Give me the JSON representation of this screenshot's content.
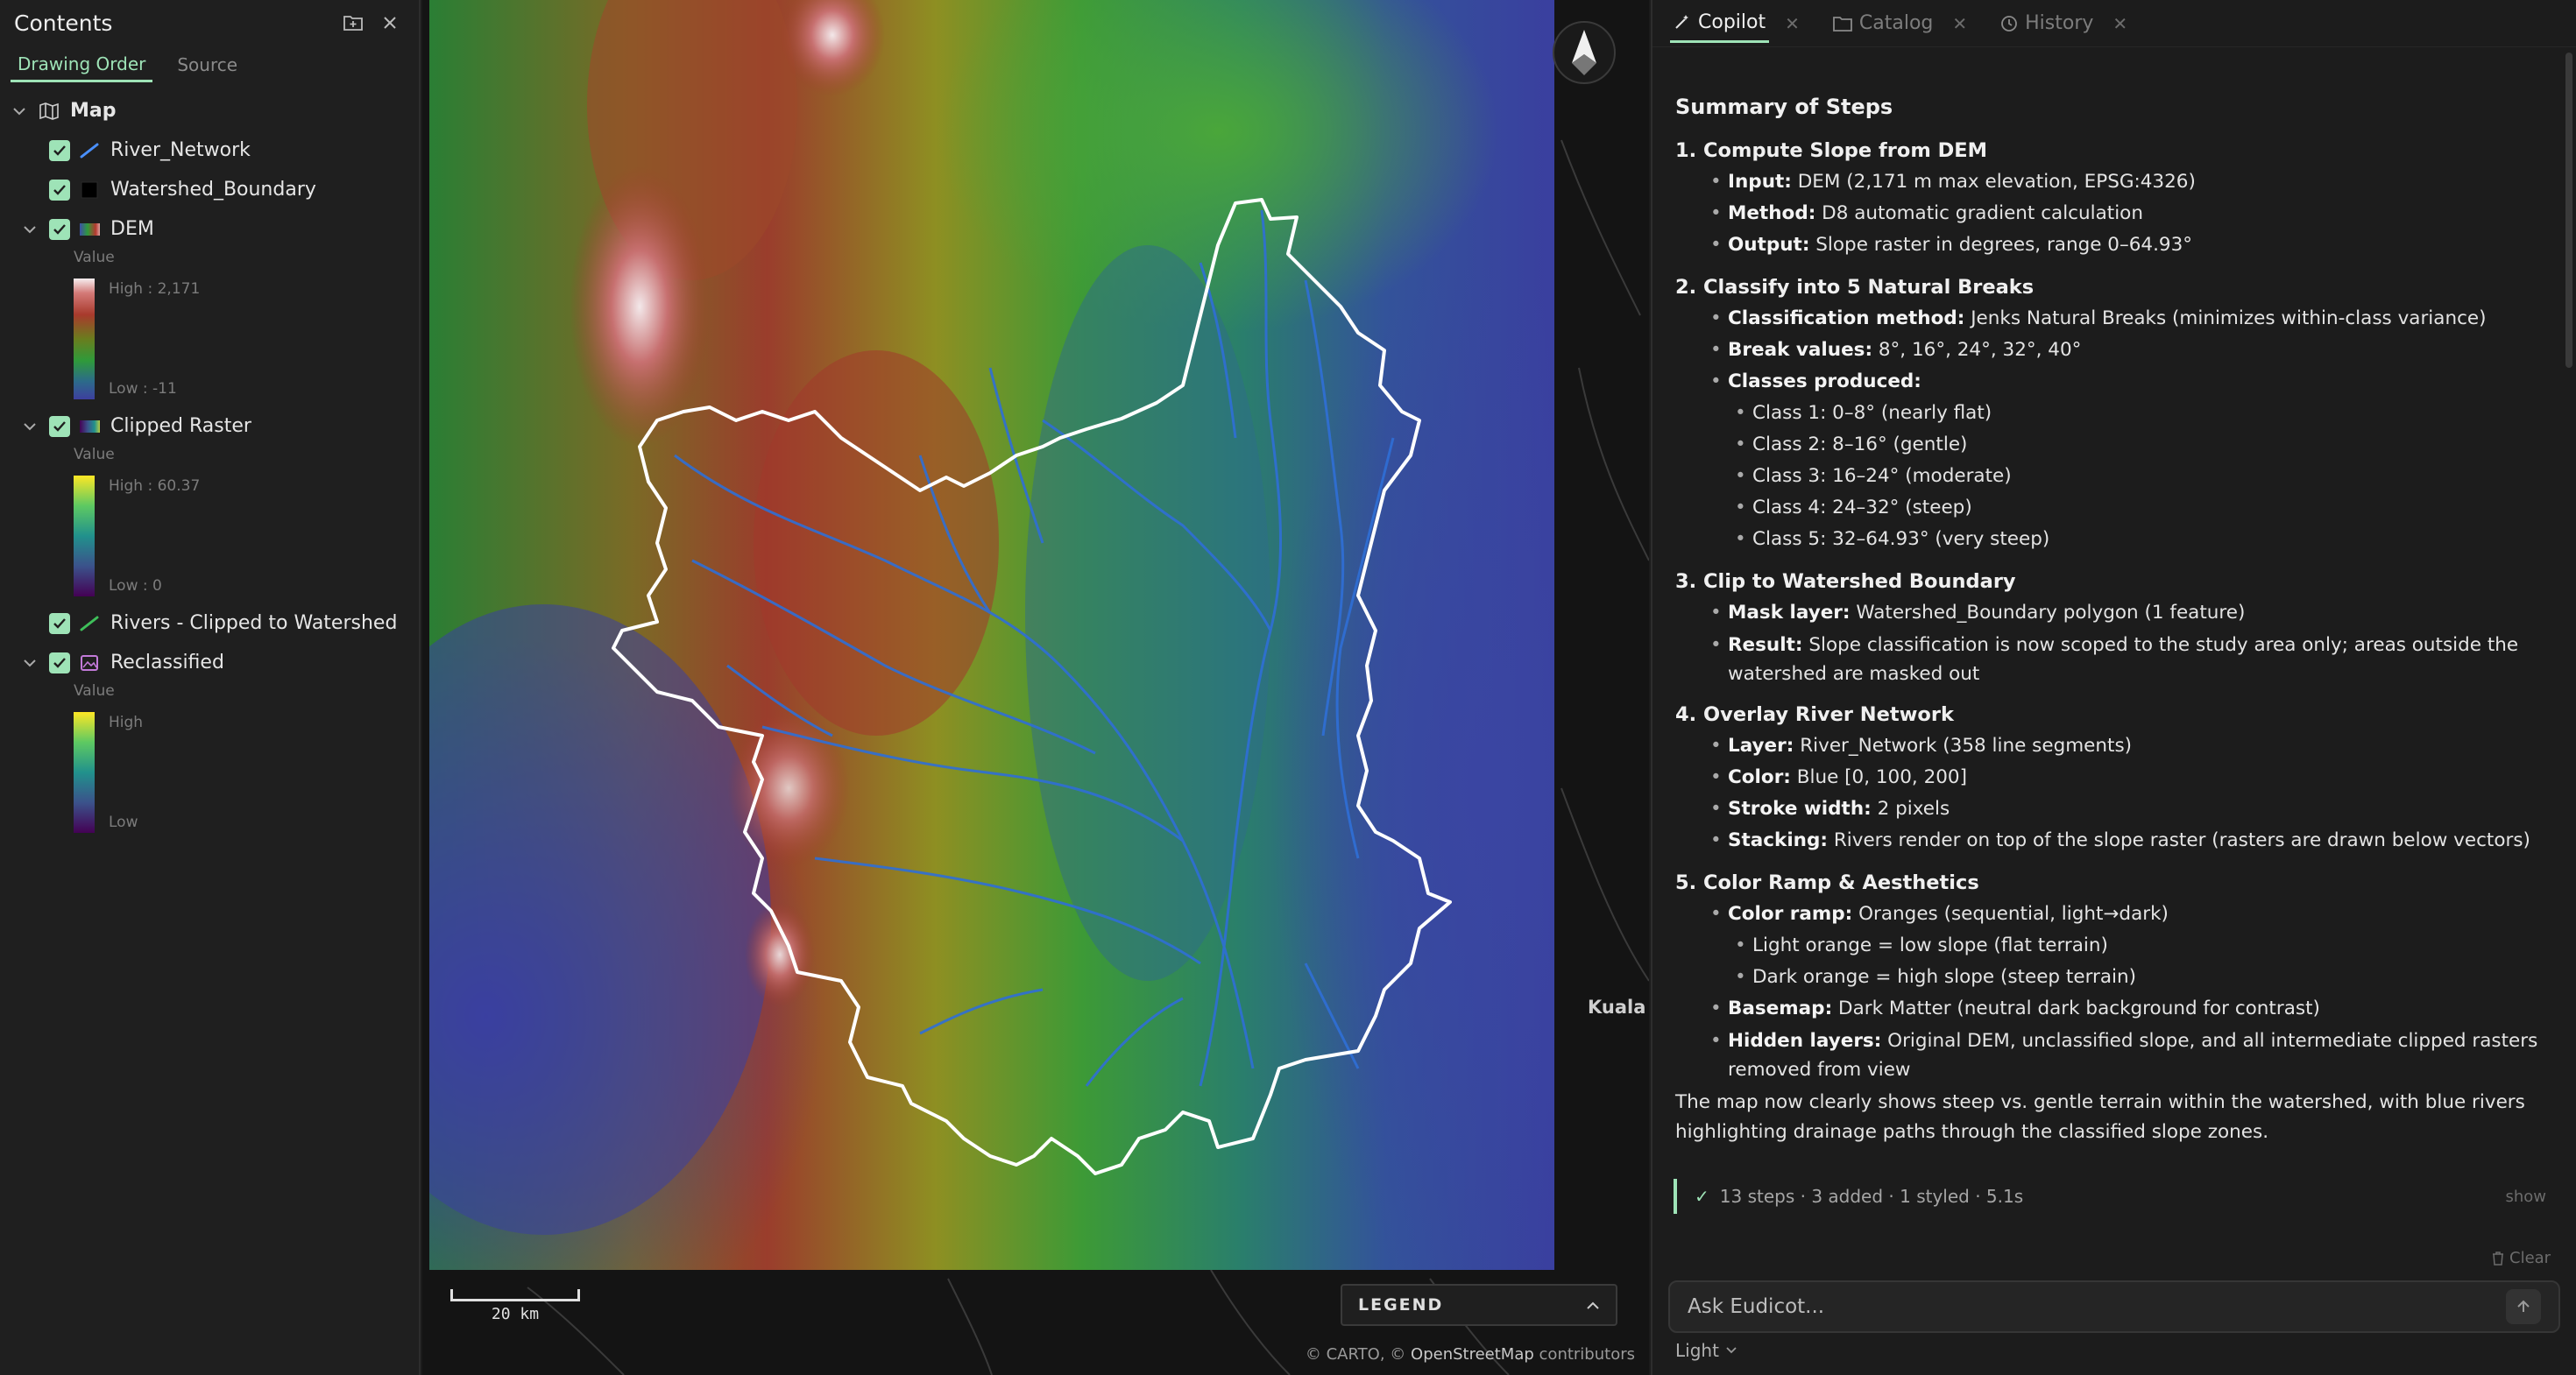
{
  "contents": {
    "title": "Contents",
    "tabs": [
      "Drawing Order",
      "Source"
    ],
    "map_label": "Map",
    "layers": [
      {
        "name": "River_Network"
      },
      {
        "name": "Watershed_Boundary"
      },
      {
        "name": "DEM",
        "legend": {
          "label": "Value",
          "high": "High : 2,171",
          "low": "Low : -11"
        }
      },
      {
        "name": "Clipped Raster",
        "legend": {
          "label": "Value",
          "high": "High : 60.37",
          "low": "Low : 0"
        }
      },
      {
        "name": "Rivers - Clipped to Watershed"
      },
      {
        "name": "Reclassified",
        "legend": {
          "label": "Value",
          "high": "High",
          "low": "Low"
        }
      }
    ]
  },
  "map": {
    "place_label": "Kuala",
    "scale_label": "20 km",
    "legend_button": "LEGEND",
    "attribution_prefix": "© CARTO, ©",
    "attribution_osm": "OpenStreetMap",
    "attribution_suffix": "contributors"
  },
  "copilot": {
    "tabs": [
      {
        "label": "Copilot",
        "icon": "wand-icon"
      },
      {
        "label": "Catalog",
        "icon": "folder-icon"
      },
      {
        "label": "History",
        "icon": "clock-icon"
      }
    ],
    "heading": "Summary of Steps",
    "s1": {
      "title": "1. Compute Slope from DEM",
      "i1k": "Input:",
      "i1v": " DEM (2,171 m max elevation, EPSG:4326)",
      "i2k": "Method:",
      "i2v": " D8 automatic gradient calculation",
      "i3k": "Output:",
      "i3v": " Slope raster in degrees, range 0–64.93°"
    },
    "s2": {
      "title": "2. Classify into 5 Natural Breaks",
      "i1k": "Classification method:",
      "i1v": " Jenks Natural Breaks (minimizes within-class variance)",
      "i2k": "Break values:",
      "i2v": " 8°, 16°, 24°, 32°, 40°",
      "i3k": "Classes produced:",
      "c1": "Class 1: 0–8° (nearly flat)",
      "c2": "Class 2: 8–16° (gentle)",
      "c3": "Class 3: 16–24° (moderate)",
      "c4": "Class 4: 24–32° (steep)",
      "c5": "Class 5: 32–64.93° (very steep)"
    },
    "s3": {
      "title": "3. Clip to Watershed Boundary",
      "i1k": "Mask layer:",
      "i1v": " Watershed_Boundary polygon (1 feature)",
      "i2k": "Result:",
      "i2v": " Slope classification is now scoped to the study area only; areas outside the watershed are masked out"
    },
    "s4": {
      "title": "4. Overlay River Network",
      "i1k": "Layer:",
      "i1v": " River_Network (358 line segments)",
      "i2k": "Color:",
      "i2v": " Blue [0, 100, 200]",
      "i3k": "Stroke width:",
      "i3v": " 2 pixels",
      "i4k": "Stacking:",
      "i4v": " Rivers render on top of the slope raster (rasters are drawn below vectors)"
    },
    "s5": {
      "title": "5. Color Ramp & Aesthetics",
      "i1k": "Color ramp:",
      "i1v": " Oranges (sequential, light→dark)",
      "c1": "Light orange = low slope (flat terrain)",
      "c2": "Dark orange = high slope (steep terrain)",
      "i2k": "Basemap:",
      "i2v": " Dark Matter (neutral dark background for contrast)",
      "i3k": "Hidden layers:",
      "i3v": " Original DEM, unclassified slope, and all intermediate clipped rasters removed from view"
    },
    "final": "The map now clearly shows steep vs. gentle terrain within the watershed, with blue rivers highlighting drainage paths through the classified slope zones.",
    "steps_summary": "13 steps · 3 added · 1 styled · 5.1s",
    "show_label": "show",
    "clear_label": "Clear",
    "ask_placeholder": "Ask Eudicot...",
    "theme_label": "Light"
  },
  "colors": {
    "accent": "#9ee3b7",
    "river": "#2f6fd6",
    "boundary": "#ffffff"
  }
}
